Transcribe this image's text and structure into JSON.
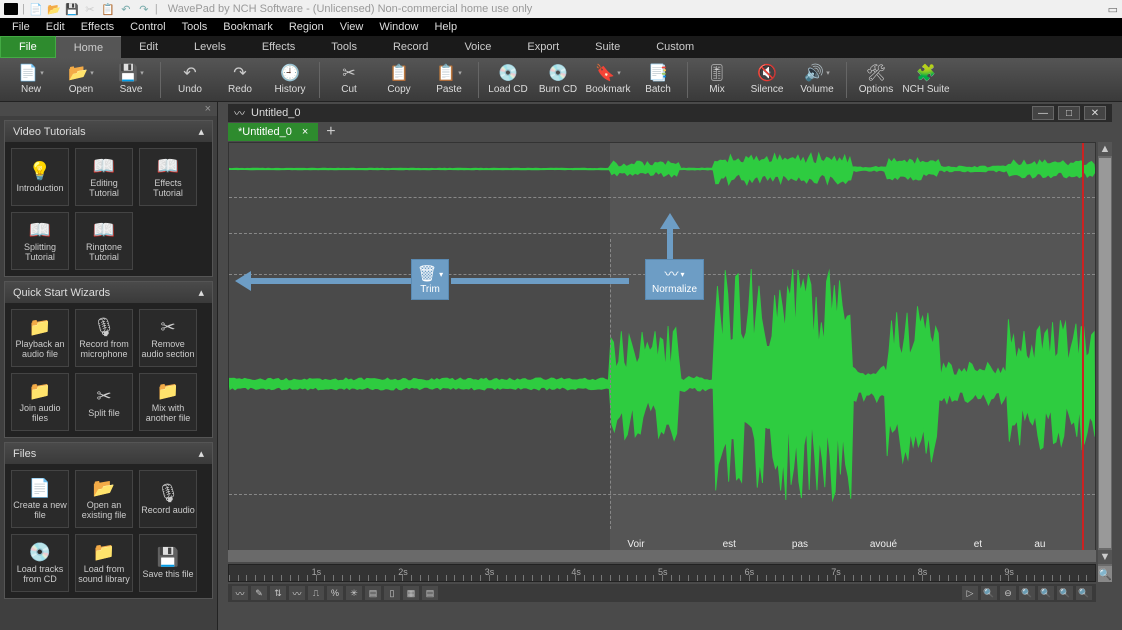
{
  "title": "WavePad by NCH Software - (Unlicensed) Non-commercial home use only",
  "menubar": [
    "File",
    "Edit",
    "Effects",
    "Control",
    "Tools",
    "Bookmark",
    "Region",
    "View",
    "Window",
    "Help"
  ],
  "tabs": {
    "file": "File",
    "items": [
      "Home",
      "Edit",
      "Levels",
      "Effects",
      "Tools",
      "Record",
      "Voice",
      "Export",
      "Suite",
      "Custom"
    ],
    "active": 0
  },
  "ribbon": {
    "groups": [
      [
        "New",
        "Open",
        "Save"
      ],
      [
        "Undo",
        "Redo",
        "History"
      ],
      [
        "Cut",
        "Copy",
        "Paste"
      ],
      [
        "Load CD",
        "Burn CD",
        "Bookmark",
        "Batch"
      ],
      [
        "Mix",
        "Silence",
        "Volume"
      ],
      [
        "Options",
        "NCH Suite"
      ]
    ]
  },
  "sidepanel": {
    "sections": [
      {
        "title": "Video Tutorials",
        "items": [
          "Introduction",
          "Editing Tutorial",
          "Effects Tutorial",
          "Splitting Tutorial",
          "Ringtone Tutorial"
        ]
      },
      {
        "title": "Quick Start Wizards",
        "items": [
          "Playback an audio file",
          "Record from microphone",
          "Remove audio section",
          "Join audio files",
          "Split file",
          "Mix with another file"
        ]
      },
      {
        "title": "Files",
        "items": [
          "Create a new file",
          "Open an existing file",
          "Record audio",
          "Load tracks from CD",
          "Load from sound library",
          "Save this file"
        ]
      }
    ]
  },
  "document": {
    "title": "Untitled_0",
    "tab_label": "*Untitled_0",
    "labels": [
      {
        "text": "Voir",
        "pos": 46
      },
      {
        "text": "est",
        "pos": 57
      },
      {
        "text": "pas",
        "pos": 65
      },
      {
        "text": "avoué",
        "pos": 74
      },
      {
        "text": "et",
        "pos": 86
      },
      {
        "text": "au",
        "pos": 93
      }
    ],
    "seconds": [
      "1s",
      "2s",
      "3s",
      "4s",
      "5s",
      "6s",
      "7s",
      "8s",
      "9s"
    ],
    "selection": {
      "start": 0,
      "end": 44
    },
    "cursor_pct": 98.5
  },
  "callouts": {
    "trim": "Trim",
    "normalize": "Normalize"
  },
  "icons": {
    "new": "📄",
    "open": "📂",
    "save": "💾",
    "undo": "↶",
    "redo": "↷",
    "history": "🕘",
    "cut": "✂",
    "copy": "📋",
    "paste": "📋",
    "loadcd": "💿",
    "burncd": "💿",
    "bookmark": "🔖",
    "batch": "📑",
    "mix": "🎚",
    "silence": "🔇",
    "volume": "🔊",
    "options": "🛠",
    "suite": "🧩",
    "bulb": "💡",
    "book": "📖",
    "mic": "🎙",
    "scissors": "✂",
    "cd": "💿",
    "folder": "📁",
    "trash": "🗑",
    "norm": "〰"
  }
}
